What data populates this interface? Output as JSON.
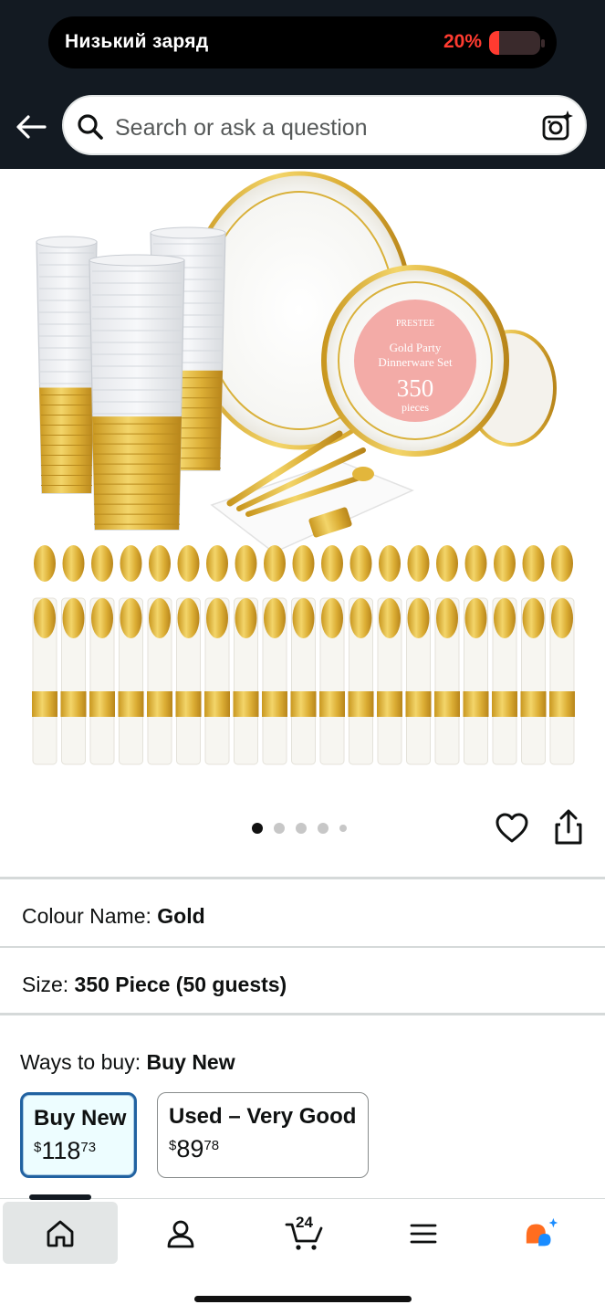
{
  "status_bar": {
    "battery_label": "Низький заряд",
    "battery_percent": "20%",
    "battery_level": 0.2,
    "battery_color": "#ff3b30"
  },
  "header": {
    "back_icon": "arrow-left-icon",
    "search_placeholder": "Search or ask a question",
    "search_icon": "search-icon",
    "camera_icon": "camera-sparkle-icon",
    "background_color": "#131a22"
  },
  "product_image": {
    "badge_brand": "PRESTEE",
    "badge_line1": "Gold Party",
    "badge_line2": "Dinnerware Set",
    "badge_number": "350",
    "badge_unit": "pieces",
    "accent_gold": "#d9b13b",
    "badge_pink": "#f2a7a4"
  },
  "carousel": {
    "dot_count": 5,
    "active_index": 0,
    "favorite_icon": "heart-icon",
    "share_icon": "share-icon"
  },
  "variations": {
    "colour_label": "Colour Name:",
    "colour_value": "Gold",
    "size_label": "Size:",
    "size_value": "350 Piece (50 guests)"
  },
  "ways_to_buy": {
    "label": "Ways to buy:",
    "value": "Buy New",
    "options": [
      {
        "label": "Buy New",
        "currency": "$",
        "whole": "118",
        "cents": "73",
        "selected": true
      },
      {
        "label": "Used – Very Good",
        "currency": "$",
        "whole": "89",
        "cents": "78",
        "selected": false
      }
    ],
    "selected_color": "#2162a1"
  },
  "bottom_nav": {
    "items": [
      "home-icon",
      "account-icon",
      "cart-icon",
      "menu-icon",
      "rufus-assistant-icon"
    ],
    "cart_count": "24",
    "active": "home-icon"
  }
}
